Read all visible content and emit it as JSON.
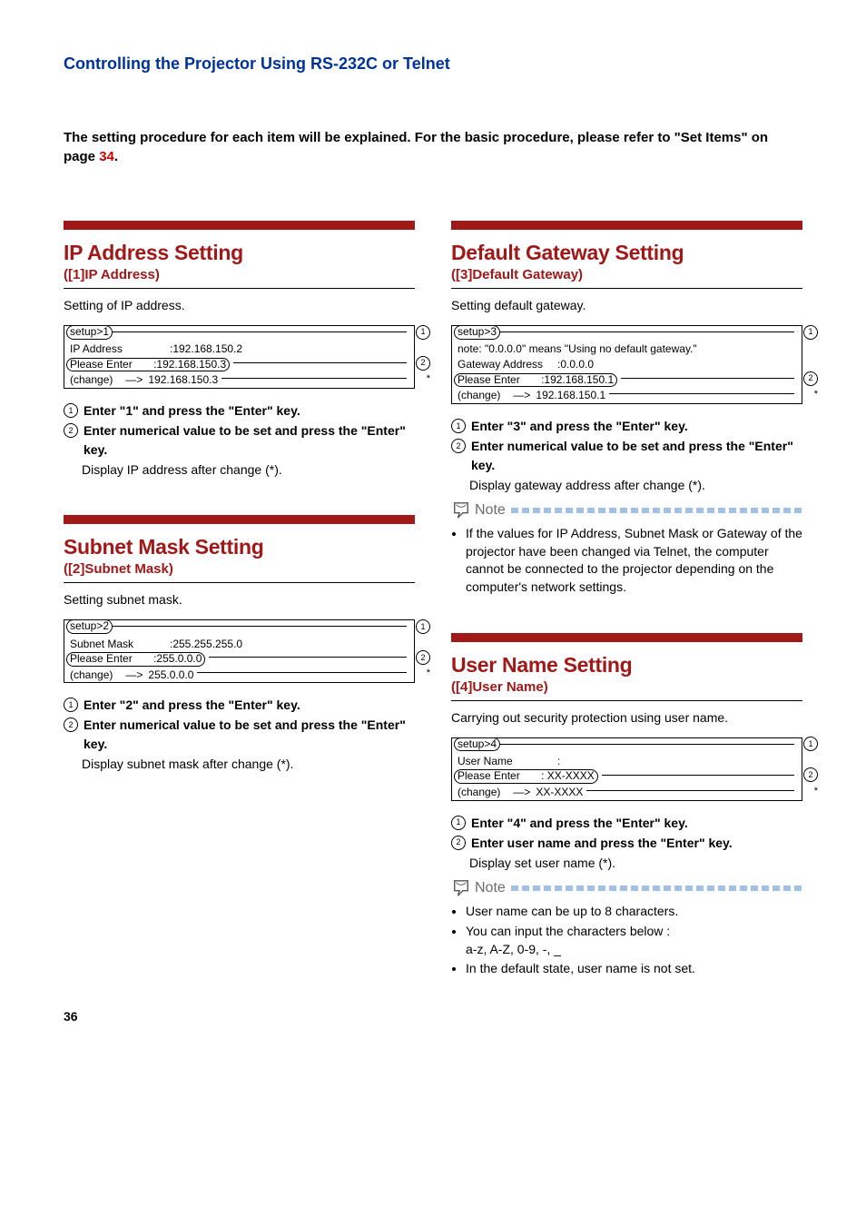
{
  "header": "Controlling the Projector Using RS-232C or Telnet",
  "intro": {
    "text_before": "The setting procedure for each item will be explained. For the basic procedure, please refer to \"Set Items\" on page ",
    "page_ref": "34",
    "text_after": "."
  },
  "sections": {
    "ip": {
      "title": "IP Address Setting",
      "subtitle": "([1]IP Address)",
      "desc": "Setting of IP address.",
      "terminal": {
        "prompt": "setup>1",
        "row1_label": "IP Address",
        "row1_value": ":192.168.150.2",
        "row2_label": "Please Enter",
        "row2_value": ":192.168.150.3",
        "row3_label": "(change)",
        "row3_arrow": "—>",
        "row3_value": "192.168.150.3"
      },
      "steps": {
        "s1": "Enter \"1\" and press the \"Enter\" key.",
        "s2": "Enter numerical value to be set and press the \"Enter\" key.",
        "after": "Display IP address after change (*)."
      }
    },
    "subnet": {
      "title": "Subnet Mask Setting",
      "subtitle": "([2]Subnet Mask)",
      "desc": "Setting subnet mask.",
      "terminal": {
        "prompt": "setup>2",
        "row1_label": "Subnet Mask",
        "row1_value": ":255.255.255.0",
        "row2_label": "Please Enter",
        "row2_value": ":255.0.0.0",
        "row3_label": "(change)",
        "row3_arrow": "—>",
        "row3_value": "255.0.0.0"
      },
      "steps": {
        "s1": "Enter \"2\" and press the \"Enter\" key.",
        "s2": "Enter numerical value to be set and press the \"Enter\" key.",
        "after": "Display subnet mask after change (*)."
      }
    },
    "gateway": {
      "title": "Default Gateway Setting",
      "subtitle": "([3]Default Gateway)",
      "desc": "Setting default gateway.",
      "terminal": {
        "prompt": "setup>3",
        "note": "note: \"0.0.0.0\" means \"Using no default gateway.\"",
        "row1_label": "Gateway Address",
        "row1_value": ":0.0.0.0",
        "row2_label": "Please Enter",
        "row2_value": ":192.168.150.1",
        "row3_label": "(change)",
        "row3_arrow": "—>",
        "row3_value": "192.168.150.1"
      },
      "steps": {
        "s1": "Enter \"3\" and press the \"Enter\" key.",
        "s2": "Enter numerical value to be set and press the \"Enter\" key.",
        "after": "Display gateway address after change (*)."
      },
      "note": {
        "label": "Note",
        "items": [
          "If the values for IP Address, Subnet Mask or Gateway of the projector have been changed via Telnet, the computer cannot be connected to the projector depending on the computer's network settings."
        ]
      }
    },
    "username": {
      "title": "User Name Setting",
      "subtitle": "([4]User Name)",
      "desc": "Carrying out security protection using user name.",
      "terminal": {
        "prompt": "setup>4",
        "row1_label": "User Name",
        "row1_value": ":",
        "row2_label": "Please Enter",
        "row2_value": ": XX-XXXX",
        "row3_label": "(change)",
        "row3_arrow": "—>",
        "row3_value": "XX-XXXX"
      },
      "steps": {
        "s1": "Enter \"4\" and press the \"Enter\" key.",
        "s2": "Enter user name and press the \"Enter\" key.",
        "after": "Display set user name (*)."
      },
      "note": {
        "label": "Note",
        "items": [
          "User name can be up to 8 characters.",
          "You can input the characters below :",
          "a-z, A-Z, 0-9, -, _",
          "In the default state, user name is not set."
        ]
      }
    }
  },
  "callouts": {
    "c1": "1",
    "c2": "2",
    "star": "*"
  },
  "page_number": "36"
}
